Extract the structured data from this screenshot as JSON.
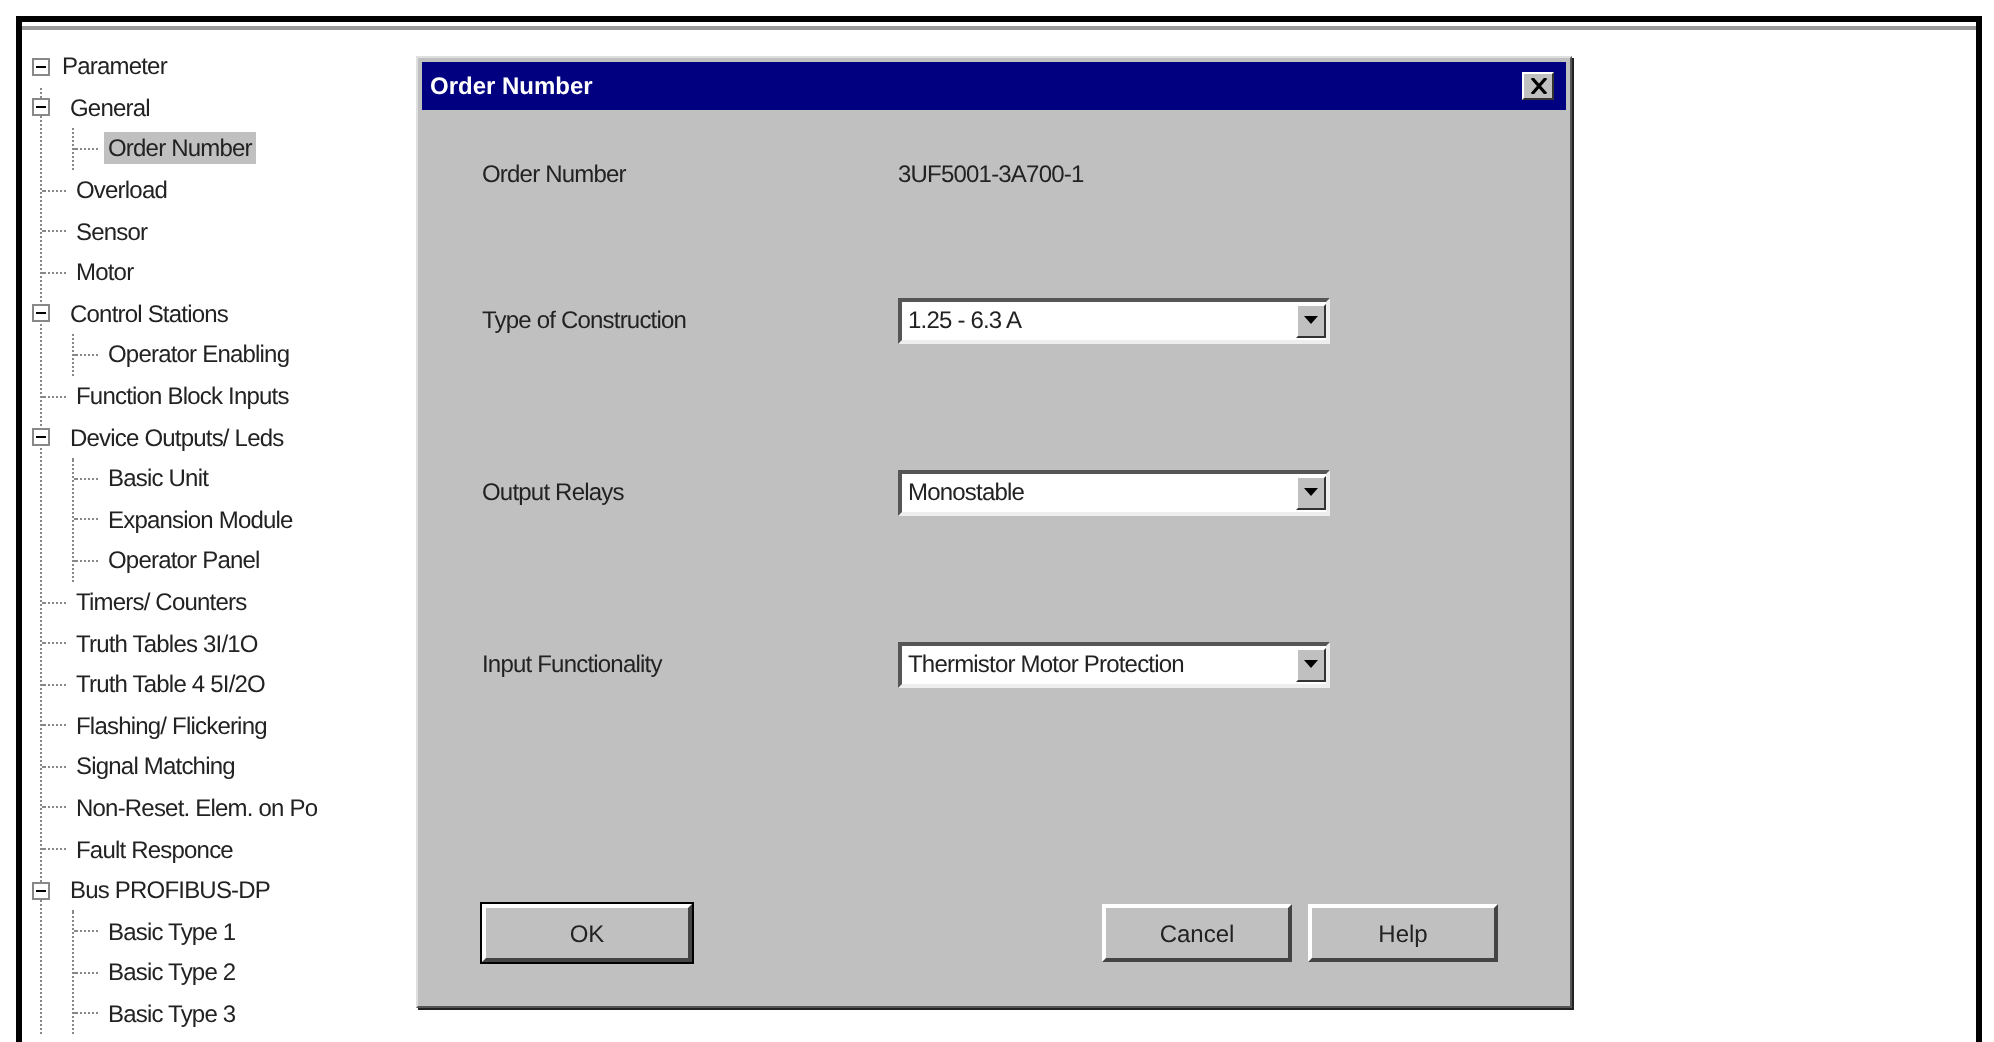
{
  "tree": {
    "label": "Parameter",
    "expanded": true,
    "selected": false,
    "children": [
      {
        "label": "General",
        "expanded": true,
        "selected": false,
        "children": [
          {
            "label": "Order Number",
            "selected": true
          }
        ]
      },
      {
        "label": "Overload",
        "selected": false
      },
      {
        "label": "Sensor",
        "selected": false
      },
      {
        "label": "Motor",
        "selected": false
      },
      {
        "label": "Control Stations",
        "expanded": true,
        "selected": false,
        "children": [
          {
            "label": "Operator Enabling",
            "selected": false
          }
        ]
      },
      {
        "label": "Function Block Inputs",
        "selected": false
      },
      {
        "label": "Device Outputs/ Leds",
        "expanded": true,
        "selected": false,
        "children": [
          {
            "label": "Basic Unit",
            "selected": false
          },
          {
            "label": "Expansion Module",
            "selected": false
          },
          {
            "label": "Operator Panel",
            "selected": false
          }
        ]
      },
      {
        "label": "Timers/ Counters",
        "selected": false
      },
      {
        "label": "Truth Tables 3I/1O",
        "selected": false
      },
      {
        "label": "Truth Table 4 5I/2O",
        "selected": false
      },
      {
        "label": "Flashing/ Flickering",
        "selected": false
      },
      {
        "label": "Signal Matching",
        "selected": false
      },
      {
        "label": "Non-Reset. Elem. on Po",
        "selected": false
      },
      {
        "label": "Fault Responce",
        "selected": false
      },
      {
        "label": "Bus PROFIBUS-DP",
        "expanded": true,
        "selected": false,
        "children": [
          {
            "label": "Basic Type 1",
            "selected": false
          },
          {
            "label": "Basic Type 2",
            "selected": false
          },
          {
            "label": "Basic Type 3",
            "selected": false
          }
        ]
      }
    ]
  },
  "dialog": {
    "title": "Order Number",
    "fields": [
      {
        "kind": "text",
        "label": "Order Number",
        "value": "3UF5001-3A700-1"
      },
      {
        "kind": "combo",
        "label": "Type of Construction",
        "value": "1.25 - 6.3 A"
      },
      {
        "kind": "combo",
        "label": "Output Relays",
        "value": "Monostable"
      },
      {
        "kind": "combo",
        "label": "Input Functionality",
        "value": "Thermistor Motor Protection"
      }
    ],
    "buttons": [
      {
        "label": "OK",
        "default": true
      },
      {
        "label": "Cancel",
        "default": false
      },
      {
        "label": "Help",
        "default": false
      }
    ]
  }
}
